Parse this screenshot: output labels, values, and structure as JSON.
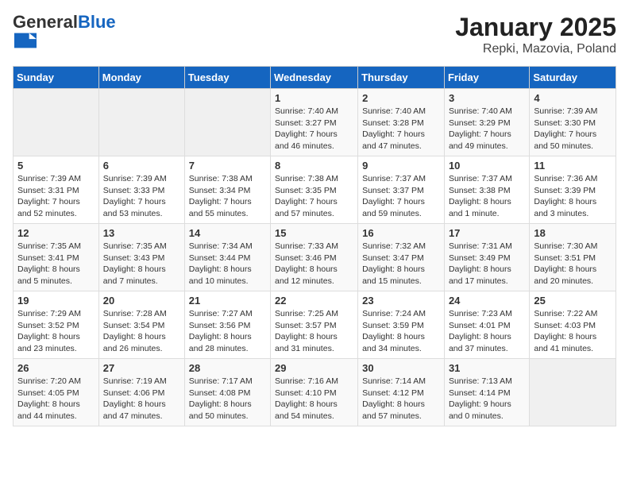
{
  "header": {
    "logo_general": "General",
    "logo_blue": "Blue",
    "title": "January 2025",
    "subtitle": "Repki, Mazovia, Poland"
  },
  "days_of_week": [
    "Sunday",
    "Monday",
    "Tuesday",
    "Wednesday",
    "Thursday",
    "Friday",
    "Saturday"
  ],
  "weeks": [
    [
      {
        "day": "",
        "info": ""
      },
      {
        "day": "",
        "info": ""
      },
      {
        "day": "",
        "info": ""
      },
      {
        "day": "1",
        "info": "Sunrise: 7:40 AM\nSunset: 3:27 PM\nDaylight: 7 hours and 46 minutes."
      },
      {
        "day": "2",
        "info": "Sunrise: 7:40 AM\nSunset: 3:28 PM\nDaylight: 7 hours and 47 minutes."
      },
      {
        "day": "3",
        "info": "Sunrise: 7:40 AM\nSunset: 3:29 PM\nDaylight: 7 hours and 49 minutes."
      },
      {
        "day": "4",
        "info": "Sunrise: 7:39 AM\nSunset: 3:30 PM\nDaylight: 7 hours and 50 minutes."
      }
    ],
    [
      {
        "day": "5",
        "info": "Sunrise: 7:39 AM\nSunset: 3:31 PM\nDaylight: 7 hours and 52 minutes."
      },
      {
        "day": "6",
        "info": "Sunrise: 7:39 AM\nSunset: 3:33 PM\nDaylight: 7 hours and 53 minutes."
      },
      {
        "day": "7",
        "info": "Sunrise: 7:38 AM\nSunset: 3:34 PM\nDaylight: 7 hours and 55 minutes."
      },
      {
        "day": "8",
        "info": "Sunrise: 7:38 AM\nSunset: 3:35 PM\nDaylight: 7 hours and 57 minutes."
      },
      {
        "day": "9",
        "info": "Sunrise: 7:37 AM\nSunset: 3:37 PM\nDaylight: 7 hours and 59 minutes."
      },
      {
        "day": "10",
        "info": "Sunrise: 7:37 AM\nSunset: 3:38 PM\nDaylight: 8 hours and 1 minute."
      },
      {
        "day": "11",
        "info": "Sunrise: 7:36 AM\nSunset: 3:39 PM\nDaylight: 8 hours and 3 minutes."
      }
    ],
    [
      {
        "day": "12",
        "info": "Sunrise: 7:35 AM\nSunset: 3:41 PM\nDaylight: 8 hours and 5 minutes."
      },
      {
        "day": "13",
        "info": "Sunrise: 7:35 AM\nSunset: 3:43 PM\nDaylight: 8 hours and 7 minutes."
      },
      {
        "day": "14",
        "info": "Sunrise: 7:34 AM\nSunset: 3:44 PM\nDaylight: 8 hours and 10 minutes."
      },
      {
        "day": "15",
        "info": "Sunrise: 7:33 AM\nSunset: 3:46 PM\nDaylight: 8 hours and 12 minutes."
      },
      {
        "day": "16",
        "info": "Sunrise: 7:32 AM\nSunset: 3:47 PM\nDaylight: 8 hours and 15 minutes."
      },
      {
        "day": "17",
        "info": "Sunrise: 7:31 AM\nSunset: 3:49 PM\nDaylight: 8 hours and 17 minutes."
      },
      {
        "day": "18",
        "info": "Sunrise: 7:30 AM\nSunset: 3:51 PM\nDaylight: 8 hours and 20 minutes."
      }
    ],
    [
      {
        "day": "19",
        "info": "Sunrise: 7:29 AM\nSunset: 3:52 PM\nDaylight: 8 hours and 23 minutes."
      },
      {
        "day": "20",
        "info": "Sunrise: 7:28 AM\nSunset: 3:54 PM\nDaylight: 8 hours and 26 minutes."
      },
      {
        "day": "21",
        "info": "Sunrise: 7:27 AM\nSunset: 3:56 PM\nDaylight: 8 hours and 28 minutes."
      },
      {
        "day": "22",
        "info": "Sunrise: 7:25 AM\nSunset: 3:57 PM\nDaylight: 8 hours and 31 minutes."
      },
      {
        "day": "23",
        "info": "Sunrise: 7:24 AM\nSunset: 3:59 PM\nDaylight: 8 hours and 34 minutes."
      },
      {
        "day": "24",
        "info": "Sunrise: 7:23 AM\nSunset: 4:01 PM\nDaylight: 8 hours and 37 minutes."
      },
      {
        "day": "25",
        "info": "Sunrise: 7:22 AM\nSunset: 4:03 PM\nDaylight: 8 hours and 41 minutes."
      }
    ],
    [
      {
        "day": "26",
        "info": "Sunrise: 7:20 AM\nSunset: 4:05 PM\nDaylight: 8 hours and 44 minutes."
      },
      {
        "day": "27",
        "info": "Sunrise: 7:19 AM\nSunset: 4:06 PM\nDaylight: 8 hours and 47 minutes."
      },
      {
        "day": "28",
        "info": "Sunrise: 7:17 AM\nSunset: 4:08 PM\nDaylight: 8 hours and 50 minutes."
      },
      {
        "day": "29",
        "info": "Sunrise: 7:16 AM\nSunset: 4:10 PM\nDaylight: 8 hours and 54 minutes."
      },
      {
        "day": "30",
        "info": "Sunrise: 7:14 AM\nSunset: 4:12 PM\nDaylight: 8 hours and 57 minutes."
      },
      {
        "day": "31",
        "info": "Sunrise: 7:13 AM\nSunset: 4:14 PM\nDaylight: 9 hours and 0 minutes."
      },
      {
        "day": "",
        "info": ""
      }
    ]
  ]
}
